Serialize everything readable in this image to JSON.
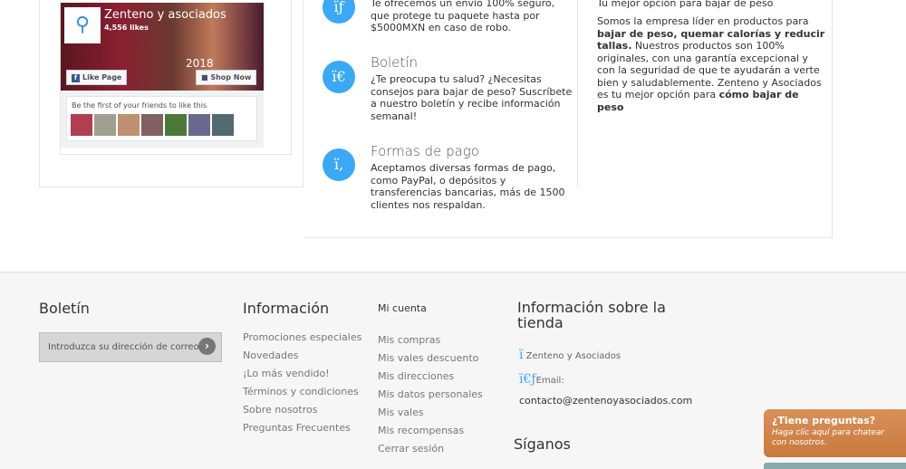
{
  "facebook_widget": {
    "page_name": "Zenteno y asociados",
    "likes": "4,556 likes",
    "year": "2018",
    "like_button": "Like Page",
    "shop_button": "Shop Now",
    "friends_text": "Be the first of your friends to like this"
  },
  "features": [
    {
      "icon": "shipping-icon",
      "glyph": "ïƒ",
      "title": "",
      "text": "Te ofrecemos un envío 100% seguro, que protege tu paquete hasta por $5000MXN en caso de robo."
    },
    {
      "icon": "newsletter-icon",
      "glyph": "ï€",
      "title": "Boletín",
      "text": "¿Te preocupa tu salud? ¿Necesitas consejos para bajar de peso? Suscríbete a nuestro boletín y recibe información semanal!"
    },
    {
      "icon": "payment-icon",
      "glyph": "ï‚",
      "title": "Formas de pago",
      "text": "Aceptamos diversas formas de pago, como PayPal, o depósitos y transferencias bancarias, más de 1500 clientes nos respaldan."
    }
  ],
  "about": {
    "heading": "Tu mejor opción para bajar de peso",
    "p1": "Somos la empresa líder en productos para ",
    "b1": "bajar de peso, quemar calorías y reducir tallas.",
    "p2": " Nuestros productos son 100% originales, con una garantía excepcional y con la seguridad de que te ayudarán a verte bien y saludablemente. Zenteno y Asociados es tu mejor opción para ",
    "b2": "cómo bajar de peso"
  },
  "footer": {
    "newsletter": {
      "title": "Boletín",
      "placeholder": "Introduzca su dirección de correo e"
    },
    "info": {
      "title": "Información",
      "items": [
        "Promociones especiales",
        "Novedades",
        "¡Lo más vendido!",
        "Términos y condiciones",
        "Sobre nosotros",
        "Preguntas Frecuentes"
      ]
    },
    "account": {
      "title": "Mi cuenta",
      "items": [
        "Mis compras",
        "Mis vales descuento",
        "Mis direcciones",
        "Mis datos personales",
        "Mis vales",
        "Mis recompensas",
        "Cerrar sesión"
      ]
    },
    "store": {
      "title": "Información sobre la tienda",
      "company_glyph": "ï",
      "company": "Zenteno y Asociados",
      "email_glyph": "ï€ƒ",
      "email_label": "Email:",
      "email": "contacto@zentenoyasociados.com"
    },
    "follow": {
      "title": "Síganos"
    }
  },
  "chat": {
    "title": "¿Tiene preguntas?",
    "text": "Haga clic aquí para chatear con nosotros."
  },
  "colors": {
    "accent": "#39a9f5",
    "chat": "#c9793d"
  }
}
